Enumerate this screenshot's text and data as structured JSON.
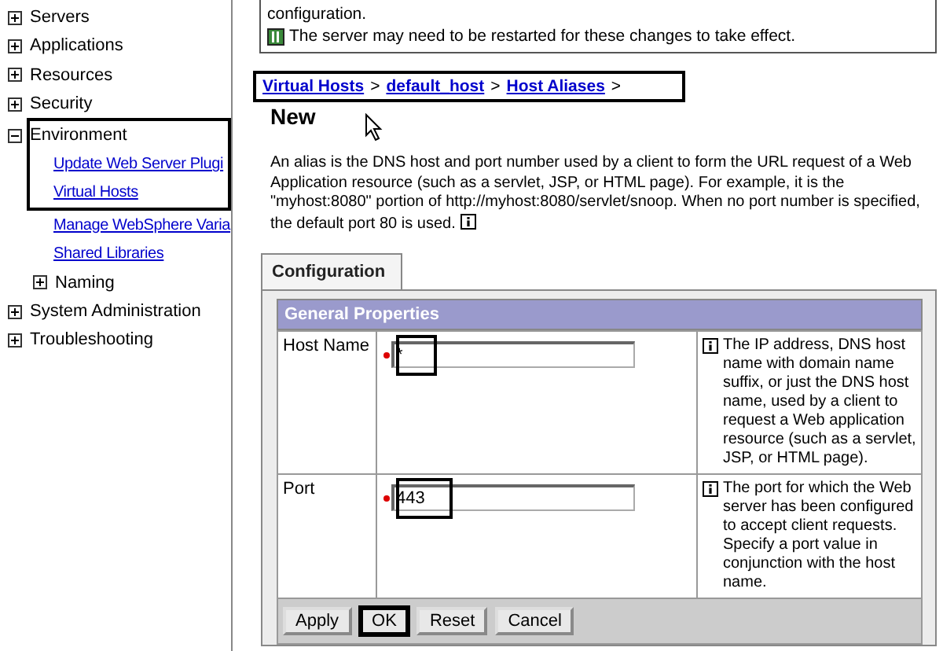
{
  "sidebar": {
    "items": [
      {
        "label": "Servers",
        "expanded": false,
        "highlighted": false
      },
      {
        "label": "Applications",
        "expanded": false,
        "highlighted": false
      },
      {
        "label": "Resources",
        "expanded": false,
        "highlighted": false
      },
      {
        "label": "Security",
        "expanded": false,
        "highlighted": false
      },
      {
        "label": "Environment",
        "expanded": true,
        "highlighted": true,
        "children": [
          {
            "kind": "link",
            "label": "Update Web Server Plugi",
            "highlighted": true
          },
          {
            "kind": "link",
            "label": "Virtual Hosts",
            "highlighted": true
          },
          {
            "kind": "link",
            "label": "Manage WebSphere Varia",
            "highlighted": false
          },
          {
            "kind": "link",
            "label": "Shared Libraries",
            "highlighted": false
          },
          {
            "kind": "node",
            "label": "Naming",
            "expanded": false,
            "highlighted": false
          }
        ]
      },
      {
        "label": "System Administration",
        "expanded": false,
        "highlighted": false
      },
      {
        "label": "Troubleshooting",
        "expanded": false,
        "highlighted": false
      }
    ]
  },
  "message": {
    "lines": [
      "configuration.",
      "The server may need to be restarted for these changes to take effect."
    ]
  },
  "breadcrumb": {
    "highlighted": true,
    "links": [
      "Virtual Hosts",
      "default_host",
      "Host Aliases"
    ],
    "separator": ">"
  },
  "page_title": "New",
  "description": "An alias is the DNS host and port number used by a client to form the URL request of a Web Application resource (such as a servlet, JSP, or HTML page). For example, it is the \"myhost:8080\" portion of http://myhost:8080/servlet/snoop. When no port number is specified, the default port 80 is used.",
  "tabs": [
    {
      "label": "Configuration",
      "selected": true
    }
  ],
  "section_title": "General Properties",
  "fields": [
    {
      "label": "Host Name",
      "required": true,
      "value": "*",
      "highlighted": true,
      "help": "The IP address, DNS host name with domain name suffix, or just the DNS host name, used by a client to request a Web application resource (such as a servlet, JSP, or HTML page)."
    },
    {
      "label": "Port",
      "required": true,
      "value": "443",
      "highlighted": true,
      "help": "The port for which the Web server has been configured to accept client requests. Specify a port value in conjunction with the host name."
    }
  ],
  "buttons": [
    {
      "label": "Apply",
      "highlighted": false
    },
    {
      "label": "OK",
      "highlighted": true
    },
    {
      "label": "Reset",
      "highlighted": false
    },
    {
      "label": "Cancel",
      "highlighted": false
    }
  ]
}
